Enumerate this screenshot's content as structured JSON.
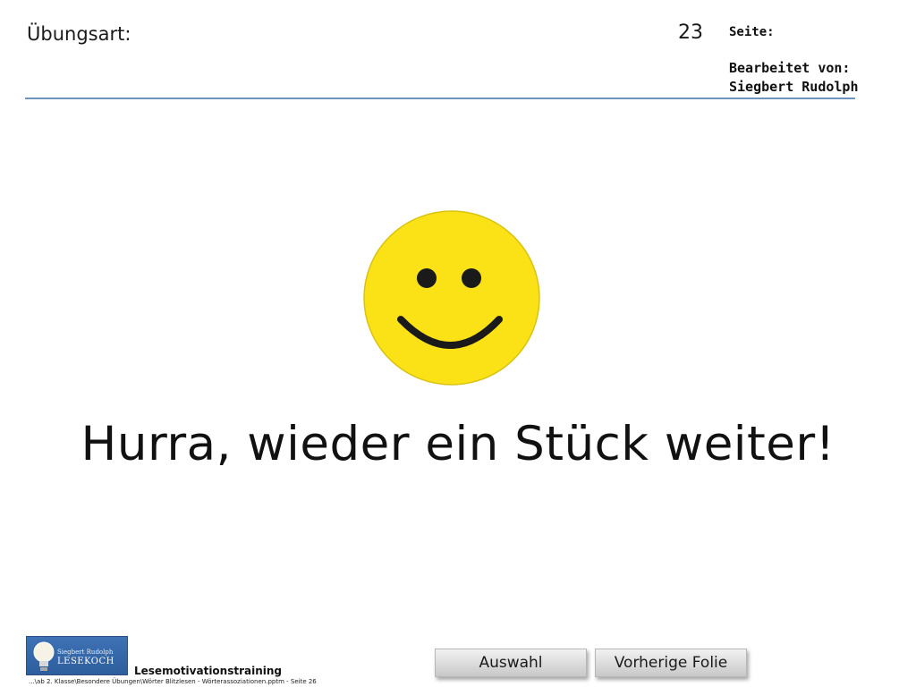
{
  "header": {
    "exercise_label": "Übungsart:",
    "page_number": "23",
    "page_label": "Seite:",
    "editor_label": "Bearbeitet von:",
    "editor_name": "Siegbert Rudolph"
  },
  "main": {
    "headline": "Hurra, wieder ein Stück weiter!",
    "smiley_icon": "smiley-face-icon"
  },
  "footer": {
    "logo_small_text": "Siegbert Rudolph",
    "logo_brand": "LESEKOCH",
    "training_label": "Lesemotivationstraining",
    "file_path": "...\\ab 2. Klasse\\Besondere Übungen\\Wörter Blitzlesen - Wörterassoziationen.pptm - Seite 26",
    "buttons": {
      "select_label": "Auswahl",
      "previous_label": "Vorherige Folie"
    }
  },
  "colors": {
    "smiley_yellow": "#FBE216",
    "rule_blue": "#6F95BF",
    "logo_blue": "#3E72B4"
  }
}
